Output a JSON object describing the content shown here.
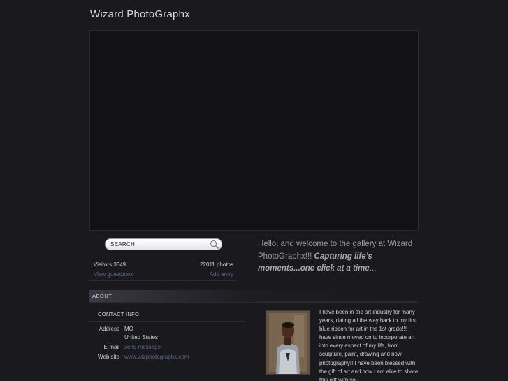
{
  "site": {
    "title": "Wizard PhotoGraphx"
  },
  "search": {
    "placeholder": "SEARCH"
  },
  "stats": {
    "visitors_label": "Visitors",
    "visitors_count": "3349",
    "photos": "22011 photos",
    "guestbook_link": "View guestbook",
    "add_entry_link": "Add entry"
  },
  "about": {
    "heading": "ABOUT",
    "contact_heading": "CONTACT INFO",
    "address_label": "Address",
    "address_line1": "MO",
    "address_line2": "United States",
    "email_label": "E-mail",
    "email_link": "send message",
    "website_label": "Web site",
    "website_link": "www.wizphotographx.com"
  },
  "welcome": {
    "intro": "Hello, and welcome to the gallery at Wizard PhotoGraphx!!! ",
    "emphasis": "Capturing life's moments...one click at a time",
    "ellipsis": "..."
  },
  "bio": {
    "text": "I have been in the art industry for many years, dating all the way back to my first blue ribbon for art in the 1st grade!!! I have since moved on to incorporate art into every aspect of my life, from sculpture, paint, drawing and now photography!! I have been blessed with the gift of art and now I am able to share this gift with you."
  },
  "colors": {
    "background": "#1a191d",
    "link": "#5b6a8c",
    "text": "#cfcfcf"
  }
}
